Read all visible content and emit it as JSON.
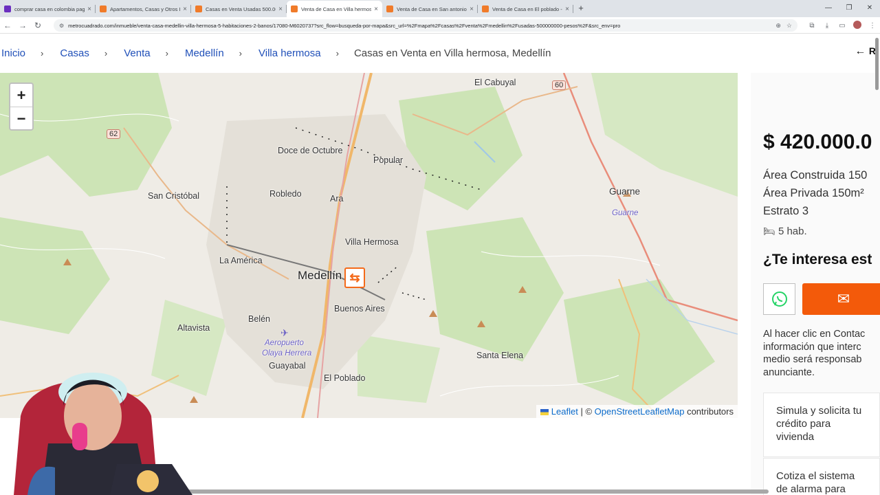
{
  "browser": {
    "tabs": [
      {
        "title": "comprar casa en colombia pago",
        "color": "#6b2fbf",
        "active": false
      },
      {
        "title": "Apartamentos, Casas y Otros Inm",
        "color": "#f07b2a",
        "active": false
      },
      {
        "title": "Casas en Venta Usadas 500.000",
        "color": "#f07b2a",
        "active": false
      },
      {
        "title": "Venta de Casa en Villa hermosa",
        "color": "#f07b2a",
        "active": true
      },
      {
        "title": "Venta de Casa en San antonio d",
        "color": "#f07b2a",
        "active": false
      },
      {
        "title": "Venta de Casa en El poblado - N",
        "color": "#f07b2a",
        "active": false
      }
    ],
    "url": "metrocuadrado.com/inmueble/venta-casa-medellin-villa-hermosa-5-habitaciones-2-banos/17080-M6020737?src_flow=busqueda-por-mapa&src_url=%2Fmapa%2Fcasas%2Fventa%2Fmedellin%2Fusadas-500000000-pesos%2F&src_env=pro"
  },
  "breadcrumb": {
    "items": [
      "Inicio",
      "Casas",
      "Venta",
      "Medellín",
      "Villa hermosa"
    ],
    "current": "Casas en Venta en Villa hermosa, Medellín",
    "back_label": "R"
  },
  "map": {
    "zoom_in": "+",
    "zoom_out": "−",
    "attribution": {
      "leaflet": "Leaflet",
      "sep": " | © ",
      "osm": "OpenStreetLeafletMap",
      "contrib": " contributors"
    },
    "labels": {
      "el_cabuyal": "El Cabuyal",
      "doce_octubre": "Doce de Octubre",
      "popular": "Popular",
      "san_cristobal": "San Cristóbal",
      "robledo": "Robledo",
      "aranjuez": "Ara",
      "guarne": "Guarne",
      "guarne_river": "Guarne",
      "villa_hermosa": "Villa Hermosa",
      "la_america": "La América",
      "medellin": "Medellín",
      "buenos_aires": "Buenos Aires",
      "belen": "Belén",
      "altavista": "Altavista",
      "aeropuerto1": "Aeropuerto",
      "aeropuerto2": "Olaya Herrera",
      "guayabal": "Guayabal",
      "santa_elena": "Santa Elena",
      "el_poblado": "El Poblado"
    },
    "shields": {
      "r62": "62",
      "r60": "60"
    }
  },
  "listing": {
    "price": "$ 420.000.0",
    "area_construida": "Área Construida 150",
    "area_privada": "Área Privada 150m²",
    "estrato": "Estrato 3",
    "rooms": "5 hab.",
    "interest_title": "¿Te interesa est",
    "disclaimer": [
      "Al hacer clic en Contac",
      "información que interc",
      "medio será responsab",
      "anunciante."
    ],
    "card1": [
      "Simula y solicita tu",
      "crédito para",
      "vivienda"
    ],
    "card2": [
      "Cotiza el sistema",
      "de alarma para"
    ]
  }
}
